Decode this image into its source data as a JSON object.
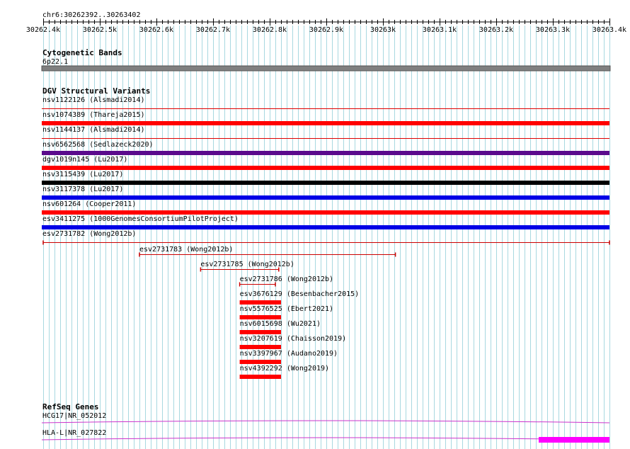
{
  "region": {
    "label": "chr6:30262392..30263402",
    "start": 30262392,
    "end": 30263402
  },
  "ruler": {
    "view_start": 30262400,
    "view_end": 30263400,
    "ticks": [
      {
        "pos": 30262400,
        "label": "30262.4k"
      },
      {
        "pos": 30262500,
        "label": "30262.5k"
      },
      {
        "pos": 30262600,
        "label": "30262.6k"
      },
      {
        "pos": 30262700,
        "label": "30262.7k"
      },
      {
        "pos": 30262800,
        "label": "30262.8k"
      },
      {
        "pos": 30262900,
        "label": "30262.9k"
      },
      {
        "pos": 30263000,
        "label": "30263k"
      },
      {
        "pos": 30263100,
        "label": "30263.1k"
      },
      {
        "pos": 30263200,
        "label": "30263.2k"
      },
      {
        "pos": 30263300,
        "label": "30263.3k"
      },
      {
        "pos": 30263400,
        "label": "30263.4k"
      }
    ]
  },
  "tracks": {
    "cytoband": {
      "title": "Cytogenetic Bands",
      "bands": [
        {
          "label": "6p22.1",
          "start": 30262400,
          "end": 30263400,
          "color": "#808080"
        }
      ]
    },
    "dgv": {
      "title": "DGV Structural Variants",
      "full_rows": [
        {
          "label": "nsv1122126 (Alsmadi2014)",
          "style": "thin",
          "color": "#e00000"
        },
        {
          "label": "nsv1074389 (Thareja2015)",
          "style": "thick",
          "color": "#ff0000"
        },
        {
          "label": "nsv1144137 (Alsmadi2014)",
          "style": "thin",
          "color": "#e00000"
        },
        {
          "label": "nsv6562568 (Sedlazeck2020)",
          "style": "thick",
          "color": "#5a0a8c"
        },
        {
          "label": "dgv1019n145 (Lu2017)",
          "style": "thick",
          "color": "#ff0000"
        },
        {
          "label": "nsv3115439 (Lu2017)",
          "style": "thick",
          "color": "#000000"
        },
        {
          "label": "nsv3117378 (Lu2017)",
          "style": "thick",
          "color": "#0000e6"
        },
        {
          "label": "nsv601264 (Cooper2011)",
          "style": "thick",
          "color": "#ff0000"
        },
        {
          "label": "esv3411275 (1000GenomesConsortiumPilotProject)",
          "style": "thick",
          "color": "#0000e6"
        },
        {
          "label": "esv2731782 (Wong2012b)",
          "style": "bracket",
          "color": "#cc0000"
        }
      ],
      "partial_rows": [
        {
          "label": "esv2731783 (Wong2012b)",
          "start": 30262570,
          "end": 30263022,
          "style": "bracket",
          "color": "#cc0000"
        },
        {
          "label": "esv2731785 (Wong2012b)",
          "start": 30262678,
          "end": 30262816,
          "style": "bracket",
          "color": "#cc0000"
        },
        {
          "label": "esv2731786 (Wong2012b)",
          "start": 30262747,
          "end": 30262810,
          "style": "bracket",
          "color": "#cc0000"
        },
        {
          "label": "esv3676129 (Besenbacher2015)",
          "start": 30262747,
          "end": 30262820,
          "style": "thick",
          "color": "#ff0000"
        },
        {
          "label": "nsv5576525 (Ebert2021)",
          "start": 30262747,
          "end": 30262820,
          "style": "thick",
          "color": "#ff0000"
        },
        {
          "label": "nsv6015698 (Wu2021)",
          "start": 30262747,
          "end": 30262820,
          "style": "thick",
          "color": "#ff0000"
        },
        {
          "label": "nsv3207619 (Chaisson2019)",
          "start": 30262747,
          "end": 30262820,
          "style": "thick",
          "color": "#ff0000"
        },
        {
          "label": "nsv3397967 (Audano2019)",
          "start": 30262747,
          "end": 30262820,
          "style": "thick",
          "color": "#ff0000"
        },
        {
          "label": "nsv4392292 (Wong2019)",
          "start": 30262747,
          "end": 30262820,
          "style": "thick",
          "color": "#ff0000"
        }
      ]
    },
    "refseq": {
      "title": "RefSeq Genes",
      "genes": [
        {
          "label": "HCG17|NR_052012",
          "color": "#cc33cc",
          "exon": null
        },
        {
          "label": "HLA-L|NR_027822",
          "color": "#cc33cc",
          "exon": {
            "start": 30263275,
            "end": 30263400,
            "color": "#ff00ff"
          }
        }
      ]
    }
  },
  "colors": {
    "grid": "#a8d8e0",
    "ruler": "#000000",
    "text": "#000000"
  }
}
